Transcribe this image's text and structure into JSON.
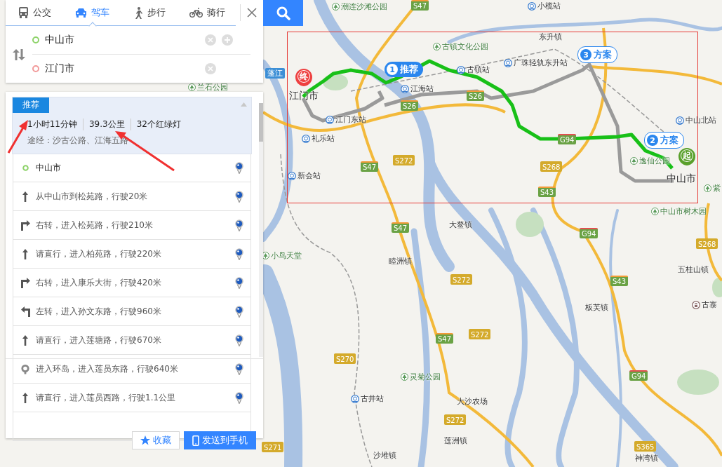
{
  "search_panel": {
    "tabs": [
      {
        "label": "公交",
        "kind": "bus",
        "selected": false
      },
      {
        "label": "驾车",
        "kind": "car",
        "selected": true
      },
      {
        "label": "步行",
        "kind": "walk",
        "selected": false
      },
      {
        "label": "骑行",
        "kind": "bike",
        "selected": false
      }
    ],
    "origin": {
      "value": "中山市"
    },
    "destination": {
      "value": "江门市"
    }
  },
  "route_panel": {
    "tag": "推荐",
    "duration": "1小时11分钟",
    "distance": "39.3公里",
    "traffic_lights": "32个红绿灯",
    "via": "途经：沙古公路、江海五路",
    "steps": [
      {
        "kind": "start",
        "text": "中山市"
      },
      {
        "kind": "straight",
        "text": "从中山市到松苑路，行驶20米"
      },
      {
        "kind": "right",
        "text": "右转，进入松苑路，行驶210米"
      },
      {
        "kind": "straight",
        "text": "请直行，进入柏苑路，行驶220米"
      },
      {
        "kind": "right",
        "text": "右转，进入康乐大街，行驶420米"
      },
      {
        "kind": "left",
        "text": "左转，进入孙文东路，行驶960米"
      },
      {
        "kind": "straight",
        "text": "请直行，进入莲塘路，行驶670米"
      },
      {
        "kind": "roundabout",
        "text": "进入环岛，进入莲员东路，行驶640米"
      },
      {
        "kind": "straight",
        "text": "请直行，进入莲员西路，行驶1.1公里"
      }
    ],
    "buttons": [
      {
        "kind": "star",
        "label": "收藏"
      },
      {
        "kind": "phone",
        "label": "发送到手机"
      }
    ]
  },
  "map": {
    "markers": [
      {
        "kind": "end",
        "label": "终"
      },
      {
        "kind": "start",
        "label": "起"
      }
    ],
    "route_bubbles": [
      {
        "number": "1",
        "label": "推荐",
        "selected": true
      },
      {
        "number": "3",
        "label": "方案",
        "selected": false
      },
      {
        "number": "2",
        "label": "方案",
        "selected": false
      }
    ],
    "labels": [
      {
        "kind": "park",
        "text": "潮连沙滩公园"
      },
      {
        "kind": "park",
        "text": "兰石公园"
      },
      {
        "kind": "station",
        "text": "小榄站"
      },
      {
        "kind": "park",
        "text": "古镇文化公园"
      },
      {
        "kind": "town",
        "text": "东升镇"
      },
      {
        "kind": "station",
        "text": "广珠轻轨东升站"
      },
      {
        "kind": "district",
        "text": "蓬江"
      },
      {
        "kind": "station",
        "text": "古镇站"
      },
      {
        "kind": "station",
        "text": "江海站"
      },
      {
        "kind": "city",
        "text": "江门市"
      },
      {
        "kind": "station",
        "text": "江门东站"
      },
      {
        "kind": "station",
        "text": "礼乐站"
      },
      {
        "kind": "station",
        "text": "中山北站"
      },
      {
        "kind": "park",
        "text": "逸仙公园"
      },
      {
        "kind": "station",
        "text": "新会站"
      },
      {
        "kind": "city",
        "text": "中山市"
      },
      {
        "kind": "park",
        "text": "紫"
      },
      {
        "kind": "park",
        "text": "中山市树木园"
      },
      {
        "kind": "town",
        "text": "大鳌镇"
      },
      {
        "kind": "park",
        "text": "小鸟天堂"
      },
      {
        "kind": "town",
        "text": "睦洲镇"
      },
      {
        "kind": "town",
        "text": "五桂山镇"
      },
      {
        "kind": "temple",
        "text": "古寨"
      },
      {
        "kind": "town",
        "text": "板芙镇"
      },
      {
        "kind": "park",
        "text": "灵菊公园"
      },
      {
        "kind": "station",
        "text": "古井站"
      },
      {
        "kind": "town",
        "text": "大沙农场"
      },
      {
        "kind": "town",
        "text": "莲洲镇"
      },
      {
        "kind": "town",
        "text": "沙堆镇"
      },
      {
        "kind": "town",
        "text": "神湾镇"
      }
    ],
    "shields": [
      {
        "kind": "expressway",
        "text": "S47"
      },
      {
        "kind": "expressway",
        "text": "S26"
      },
      {
        "kind": "expressway",
        "text": "S26"
      },
      {
        "kind": "national",
        "text": "G94"
      },
      {
        "kind": "expressway",
        "text": "S47"
      },
      {
        "kind": "provincial",
        "text": "S272"
      },
      {
        "kind": "provincial",
        "text": "S268"
      },
      {
        "kind": "expressway",
        "text": "S43"
      },
      {
        "kind": "expressway",
        "text": "S47"
      },
      {
        "kind": "national",
        "text": "G94"
      },
      {
        "kind": "provincial",
        "text": "S268"
      },
      {
        "kind": "expressway",
        "text": "S43"
      },
      {
        "kind": "provincial",
        "text": "S272"
      },
      {
        "kind": "expressway",
        "text": "S47"
      },
      {
        "kind": "provincial",
        "text": "S272"
      },
      {
        "kind": "provincial",
        "text": "S270"
      },
      {
        "kind": "provincial",
        "text": "S272"
      },
      {
        "kind": "national",
        "text": "G94"
      },
      {
        "kind": "provincial",
        "text": "S365"
      },
      {
        "kind": "provincial",
        "text": "S271"
      }
    ]
  }
}
